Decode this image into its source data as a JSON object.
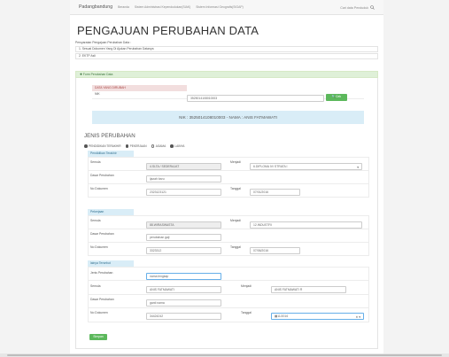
{
  "nav": {
    "brand": "Padangbandung",
    "links": [
      "Beranda",
      "Sistem Administrasi Kependudukan(SIAK)",
      "Sistem Informasi Geografis(SIGAP)"
    ],
    "search_placeholder": "Cari data Penduduk"
  },
  "header": {
    "title": "PENGAJUAN PERUBAHAN DATA",
    "subtitle": "Persyaratan Pengajuan Perubahan Data :",
    "requirements": [
      "1. Sesuai Dokumen Yang Di Ajukan Perubahan Datanya",
      "2. EKTP Asli"
    ]
  },
  "form": {
    "panel_title": "✚ Form Perubahan Data",
    "data_label": "DATA YANG DIRUBAH",
    "nik_label": "NIK",
    "nik_value": "3525014108010003",
    "cek_button": "🔍Cek",
    "banner": "NIK : 3525014108010003 - NAMA : ANIS FATMAWATI",
    "section_title": "JENIS PERUBAHAN",
    "radios": [
      {
        "label": "PENDIDIKAN TERAKHIR",
        "checked": true
      },
      {
        "label": "PEKERJAAN",
        "checked": true
      },
      {
        "label": "AGAMA",
        "checked": false
      },
      {
        "label": "LAINYA",
        "checked": true
      }
    ],
    "pendidikan": {
      "header": "Pendidikan Terakhir",
      "semula_label": "Semula",
      "semula_value": "4.SLTA / SEDERAJAT",
      "menjadi_label": "Menjadi",
      "menjadi_value": "6.DIPLOMA IV/ STRATA I",
      "dasar_label": "Dasar Perubahan",
      "dasar_value": "ijazah baru",
      "nodok_label": "No Dokumen",
      "nodok_value": "2323123121",
      "tanggal_label": "Tanggal",
      "tanggal_value": "07/01/2016"
    },
    "pekerjaan": {
      "header": "Pekerjaan",
      "semula_label": "Semula",
      "semula_value": "88.WIRASWASTA",
      "menjadi_label": "Menjadi",
      "menjadi_value": "12.INDUSTRI",
      "dasar_label": "Dasar Perubahan",
      "dasar_value": "perubahan gaji",
      "nodok_label": "No Dokumen",
      "nodok_value": "3323312",
      "tanggal_label": "Tanggal",
      "tanggal_value": "07/06/2016"
    },
    "lainya": {
      "header": "lainya Tersebut",
      "jenis_label": "Jenis Perubahan",
      "jenis_value": "nama lengkap",
      "semula_label": "Semula",
      "semula_value": "ANIS FATMAWATI",
      "menjadi_label": "Menjadi",
      "menjadi_value": "ANIS FATMAWATI R",
      "dasar_label": "Dasar Perubahan",
      "dasar_value": "ganti nama",
      "nodok_label": "No Dokumen",
      "nodok_value": "34424242",
      "tanggal_label": "Tanggal",
      "tanggal_value": "▦11/2016"
    },
    "submit_button": "Simpan"
  }
}
